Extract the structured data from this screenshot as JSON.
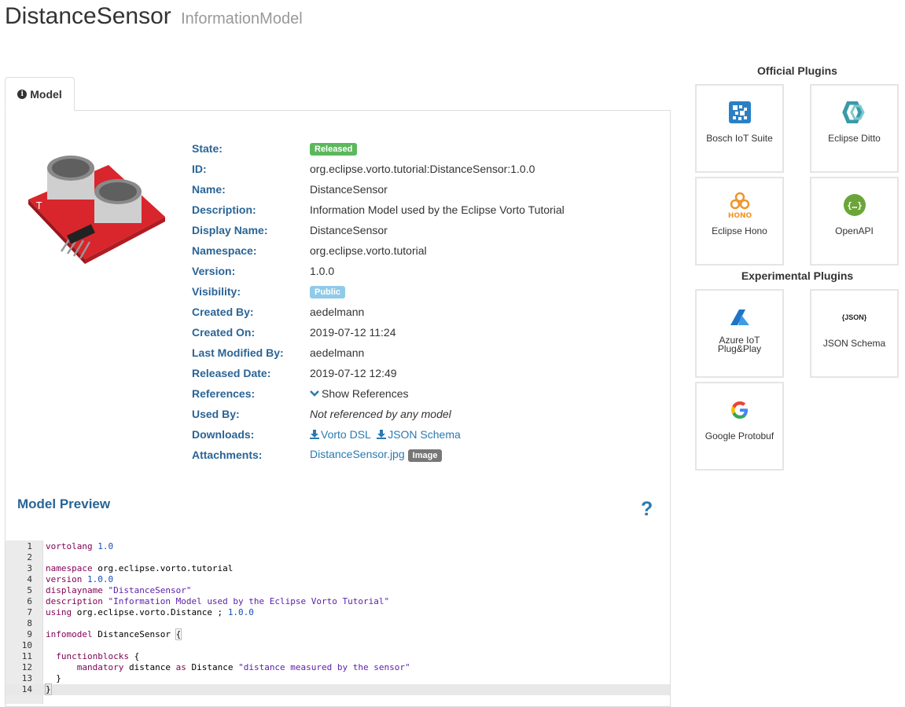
{
  "header": {
    "title": "DistanceSensor",
    "subtitle": "InformationModel"
  },
  "tabs": [
    {
      "label": "Model",
      "icon": "info-circle-icon"
    }
  ],
  "details": {
    "state": {
      "label": "State:",
      "value": "Released",
      "color": "#5cb85c"
    },
    "id": {
      "label": "ID:",
      "value": "org.eclipse.vorto.tutorial:DistanceSensor:1.0.0"
    },
    "name": {
      "label": "Name:",
      "value": "DistanceSensor"
    },
    "description": {
      "label": "Description:",
      "value": "Information Model used by the Eclipse Vorto Tutorial"
    },
    "display_name": {
      "label": "Display Name:",
      "value": "DistanceSensor"
    },
    "namespace": {
      "label": "Namespace:",
      "value": "org.eclipse.vorto.tutorial"
    },
    "version": {
      "label": "Version:",
      "value": "1.0.0"
    },
    "visibility": {
      "label": "Visibility:",
      "value": "Public",
      "color": "#8fcbe8"
    },
    "created_by": {
      "label": "Created By:",
      "value": "aedelmann"
    },
    "created_on": {
      "label": "Created On:",
      "value": "2019-07-12 11:24"
    },
    "last_modified_by": {
      "label": "Last Modified By:",
      "value": "aedelmann"
    },
    "released_date": {
      "label": "Released Date:",
      "value": "2019-07-12 12:49"
    },
    "references": {
      "label": "References:",
      "value": "Show References"
    },
    "used_by": {
      "label": "Used By:",
      "value": "Not referenced by any model"
    },
    "downloads": {
      "label": "Downloads:",
      "vorto_dsl": "Vorto DSL",
      "json_schema": "JSON Schema"
    },
    "attachments": {
      "label": "Attachments:",
      "file": "DistanceSensor.jpg",
      "badge": "Image"
    }
  },
  "preview": {
    "title": "Model Preview",
    "help": "?",
    "code_lines": [
      {
        "n": "1",
        "parts": [
          [
            "kw",
            "vortolang "
          ],
          [
            "num",
            "1.0"
          ]
        ]
      },
      {
        "n": "2",
        "parts": []
      },
      {
        "n": "3",
        "parts": [
          [
            "kw",
            "namespace "
          ],
          [
            "plain",
            "org.eclipse.vorto.tutorial"
          ]
        ]
      },
      {
        "n": "4",
        "parts": [
          [
            "kw",
            "version "
          ],
          [
            "num",
            "1.0.0"
          ]
        ]
      },
      {
        "n": "5",
        "parts": [
          [
            "kw",
            "displayname "
          ],
          [
            "str",
            "\"DistanceSensor\""
          ]
        ]
      },
      {
        "n": "6",
        "parts": [
          [
            "kw",
            "description "
          ],
          [
            "str",
            "\"Information Model used by the Eclipse Vorto Tutorial\""
          ]
        ]
      },
      {
        "n": "7",
        "parts": [
          [
            "kw",
            "using "
          ],
          [
            "plain",
            "org.eclipse.vorto.Distance ; "
          ],
          [
            "num",
            "1.0.0"
          ]
        ]
      },
      {
        "n": "8",
        "parts": []
      },
      {
        "n": "9",
        "parts": [
          [
            "kw",
            "infomodel "
          ],
          [
            "plain",
            "DistanceSensor "
          ],
          [
            "bracket",
            "{"
          ]
        ]
      },
      {
        "n": "10",
        "parts": []
      },
      {
        "n": "11",
        "parts": [
          [
            "plain",
            "  "
          ],
          [
            "kw",
            "functionblocks "
          ],
          [
            "plain",
            "{"
          ]
        ]
      },
      {
        "n": "12",
        "parts": [
          [
            "plain",
            "      "
          ],
          [
            "kw",
            "mandatory "
          ],
          [
            "plain",
            "distance "
          ],
          [
            "kw",
            "as "
          ],
          [
            "plain",
            "Distance "
          ],
          [
            "str",
            "\"distance measured by the sensor\""
          ]
        ]
      },
      {
        "n": "13",
        "parts": [
          [
            "plain",
            "  }"
          ]
        ]
      },
      {
        "n": "14",
        "parts": [
          [
            "bracket",
            "}"
          ]
        ],
        "active": true
      }
    ]
  },
  "official_plugins": {
    "title": "Official Plugins",
    "items": [
      {
        "name": "Bosch IoT Suite",
        "icon": "bosch-iot-suite-icon"
      },
      {
        "name": "Eclipse Ditto",
        "icon": "eclipse-ditto-icon"
      },
      {
        "name": "Eclipse Hono",
        "icon": "eclipse-hono-icon",
        "icon_text": "HONO"
      },
      {
        "name": "OpenAPI",
        "icon": "openapi-icon"
      }
    ]
  },
  "experimental_plugins": {
    "title": "Experimental Plugins",
    "items": [
      {
        "name": "Azure IoT Plug&Play",
        "icon": "azure-icon"
      },
      {
        "name": "JSON Schema",
        "icon": "json-icon",
        "icon_text": "{JSON}"
      },
      {
        "name": "Google Protobuf",
        "icon": "google-icon"
      }
    ]
  },
  "colors": {
    "label_blue": "#2a6496",
    "link_blue": "#2a7ab0",
    "released_green": "#5cb85c",
    "public_blue": "#8fcbe8"
  }
}
